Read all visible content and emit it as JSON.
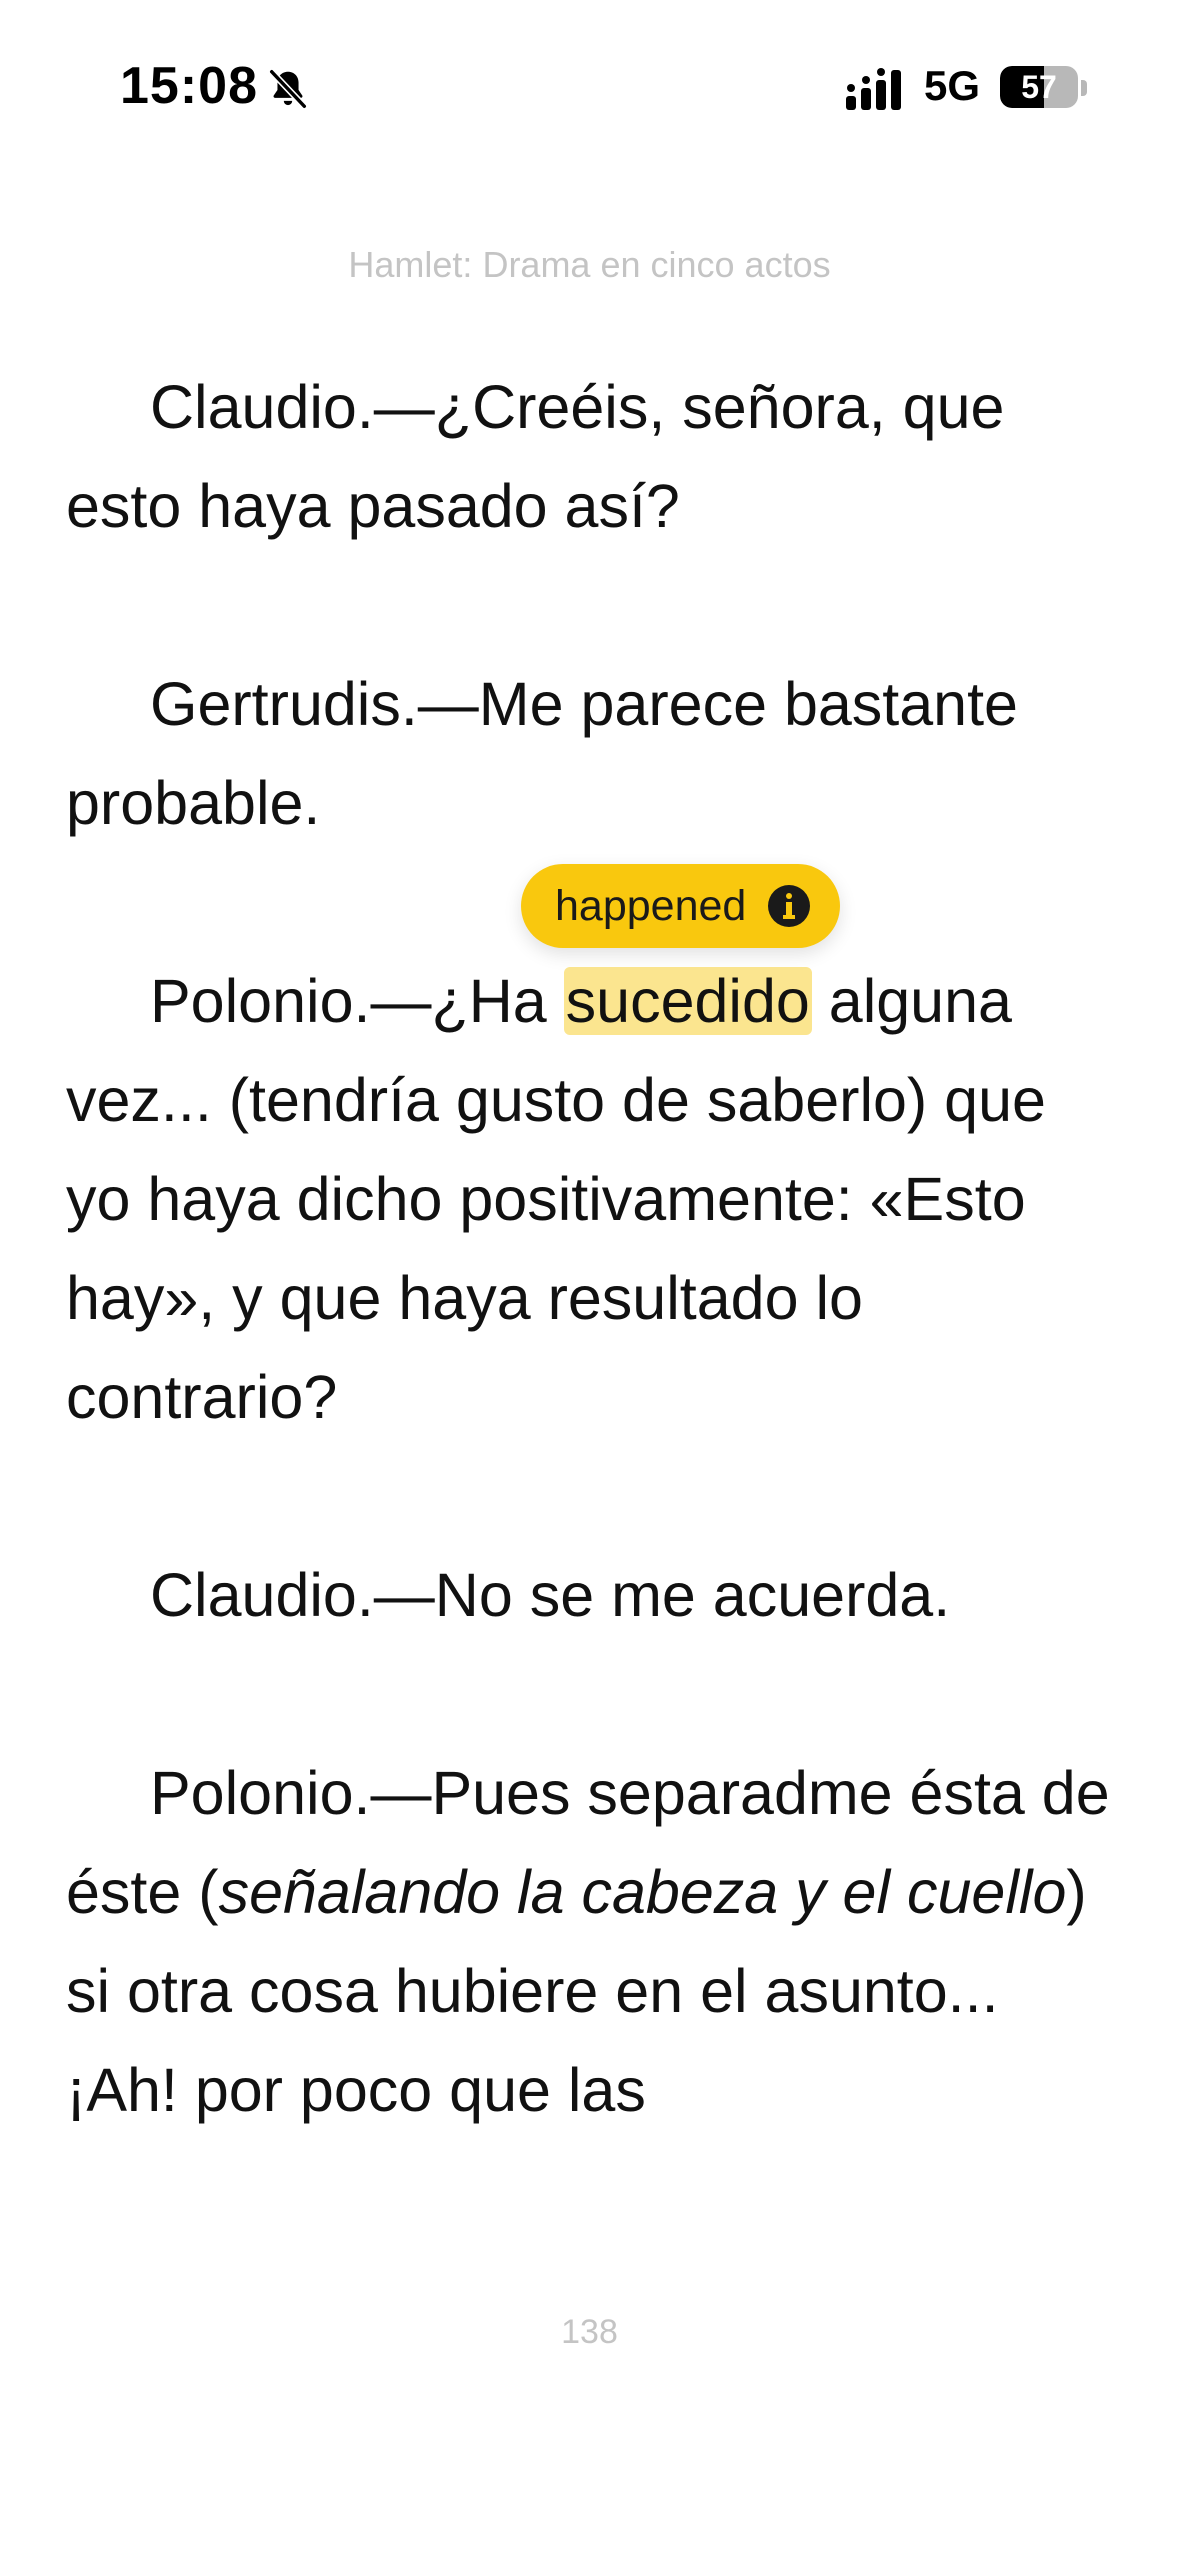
{
  "status_bar": {
    "time": "15:08",
    "network": "5G",
    "battery": "57",
    "battery_level": 0.57,
    "icons": [
      "bell-slash-icon",
      "signal-icon",
      "battery-icon"
    ]
  },
  "book": {
    "title": "Hamlet: Drama en cinco actos",
    "page_number": "138"
  },
  "tooltip": {
    "translation": "happened",
    "icon": "info-icon",
    "color": "#f9c80e"
  },
  "highlight_color": "#fbe58f",
  "paragraphs": {
    "p1": "Claudio.—¿Creéis, señora, que esto haya pasado así?",
    "p2": "Gertrudis.—Me parece bastante probable.",
    "p3_before": "Polonio.—¿Ha ",
    "p3_highlight": "sucedido",
    "p3_after": " alguna vez... (tendría gusto de saberlo) que yo haya dicho positivamente: «Esto hay», y que haya resultado lo contrario?",
    "p4": "Claudio.—No se me acuerda.",
    "p5_before": "Polonio.—Pues separadme ésta de éste (",
    "p5_italic": "señalando la cabeza y el cuello",
    "p5_after": ") si otra cosa hubiere en el asunto... ¡Ah! por poco que las"
  }
}
